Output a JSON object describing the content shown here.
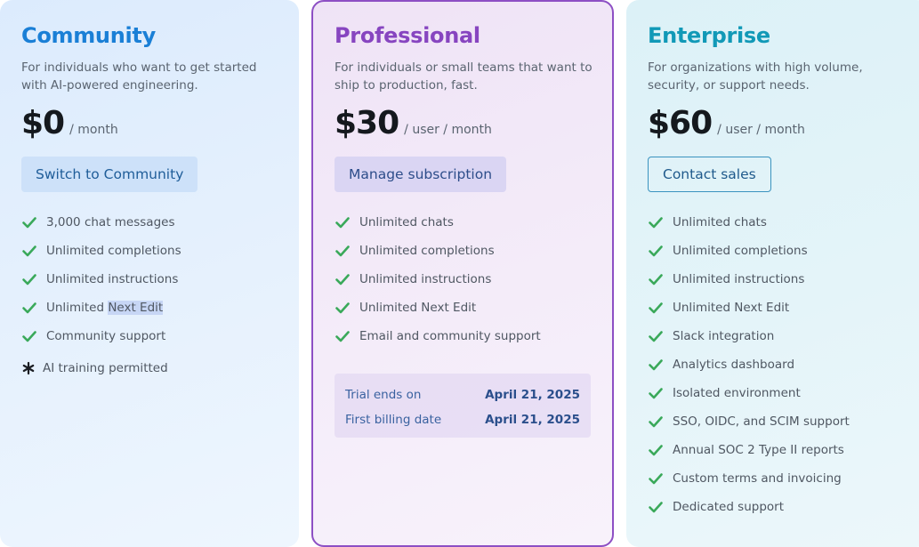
{
  "colors": {
    "community_accent": "#1a7fd6",
    "professional_accent": "#8745c0",
    "enterprise_accent": "#1199b7",
    "check": "#3aa95a"
  },
  "plans": [
    {
      "name": "Community",
      "description": "For individuals who want to get started with AI-powered engineering.",
      "price": "$0",
      "period": "/ month",
      "cta": "Switch to Community",
      "features_before_highlight": [
        "3,000 chat messages",
        "Unlimited completions",
        "Unlimited instructions"
      ],
      "highlight_feature": {
        "prefix": "Unlimited ",
        "highlight": "Next Edit"
      },
      "features_after_highlight": [
        "Community support"
      ],
      "note": "AI training permitted"
    },
    {
      "name": "Professional",
      "description": "For individuals or small teams that want to ship to production, fast.",
      "price": "$30",
      "period": "/ user / month",
      "cta": "Manage subscription",
      "features": [
        "Unlimited chats",
        "Unlimited completions",
        "Unlimited instructions",
        "Unlimited Next Edit",
        "Email and community support"
      ],
      "trial": {
        "ends_label": "Trial ends on",
        "ends_value": "April 21, 2025",
        "billing_label": "First billing date",
        "billing_value": "April 21, 2025"
      }
    },
    {
      "name": "Enterprise",
      "description": "For organizations with high volume, security, or support needs.",
      "price": "$60",
      "period": "/ user / month",
      "cta": "Contact sales",
      "features": [
        "Unlimited chats",
        "Unlimited completions",
        "Unlimited instructions",
        "Unlimited Next Edit",
        "Slack integration",
        "Analytics dashboard",
        "Isolated environment",
        "SSO, OIDC, and SCIM support",
        "Annual SOC 2 Type II reports",
        "Custom terms and invoicing",
        "Dedicated support"
      ]
    }
  ]
}
